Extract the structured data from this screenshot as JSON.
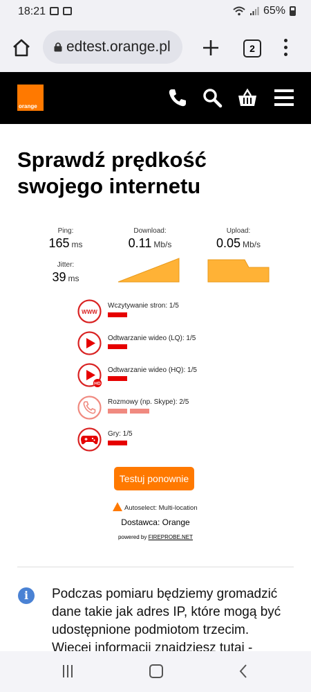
{
  "status": {
    "time": "18:21",
    "battery": "65%"
  },
  "browser": {
    "url": "edtest.orange.pl",
    "tab_count": "2"
  },
  "site": {
    "logo_text": "orange"
  },
  "page": {
    "title": "Sprawdź prędkość swojego internetu"
  },
  "metrics": {
    "ping": {
      "label": "Ping:",
      "value": "165",
      "unit": "ms"
    },
    "jitter": {
      "label": "Jitter:",
      "value": "39",
      "unit": "ms"
    },
    "download": {
      "label": "Download:",
      "value": "0.11",
      "unit": "Mb/s"
    },
    "upload": {
      "label": "Upload:",
      "value": "0.05",
      "unit": "Mb/s"
    }
  },
  "quality": [
    {
      "icon": "www-icon",
      "label": "Wczytywanie stron: 1/5",
      "score": 1
    },
    {
      "icon": "play-icon",
      "label": "Odtwarzanie wideo (LQ): 1/5",
      "score": 1
    },
    {
      "icon": "play-hd-icon",
      "label": "Odtwarzanie wideo (HQ): 1/5",
      "score": 1
    },
    {
      "icon": "phone-icon",
      "label": "Rozmowy (np. Skype): 2/5",
      "score": 2
    },
    {
      "icon": "gamepad-icon",
      "label": "Gry: 1/5",
      "score": 1
    }
  ],
  "retest_button": "Testuj ponownie",
  "autoselect": "Autoselect: Multi-location",
  "provider": "Dostawca: Orange",
  "powered_by": {
    "prefix": "powered by ",
    "link": "FIREPROBE.NET"
  },
  "info_text": "Podczas pomiaru będziemy gromadzić dane takie jak adres IP, które mogą być udostępnione podmiotom trzecim. Więcej informacji znajdziesz tutaj -",
  "colors": {
    "orange": "#ff7900",
    "red": "#e60000",
    "light_red": "#f08a80"
  }
}
